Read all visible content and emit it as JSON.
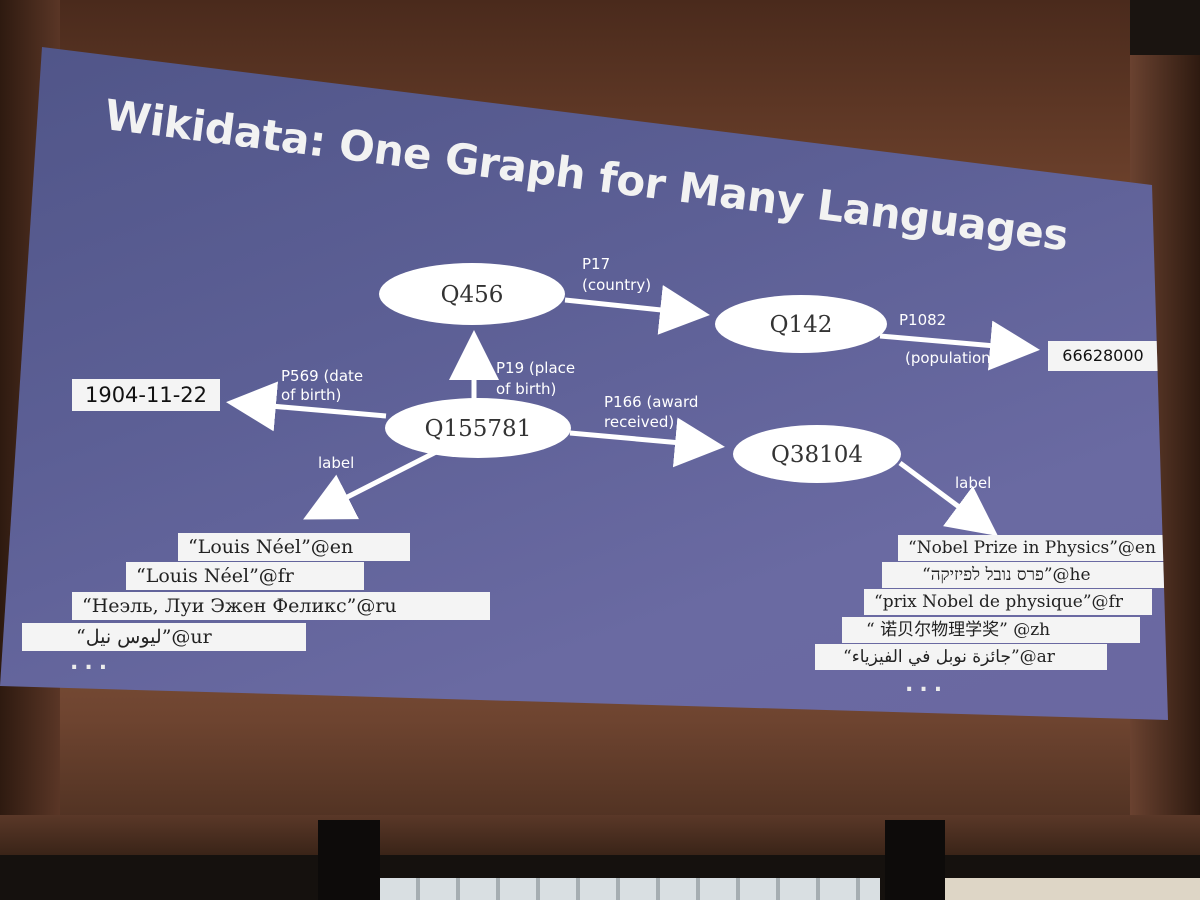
{
  "slide": {
    "title": "Wikidata: One Graph for Many Languages"
  },
  "nodes": {
    "q456": "Q456",
    "q142": "Q142",
    "q155781": "Q155781",
    "q38104": "Q38104"
  },
  "values": {
    "population": "66628000",
    "birth_date": "1904-11-22"
  },
  "edges": {
    "p17_line1": "P17",
    "p17_line2": "(country)",
    "p1082_line1": "P1082",
    "p1082_line2": "(population)",
    "p569_line1": "P569 (date",
    "p569_line2": "of birth)",
    "p19_line1": "P19 (place",
    "p19_line2": "of birth)",
    "p166_line1": "P166 (award",
    "p166_line2": "received)",
    "label_left": "label",
    "label_right": "label"
  },
  "person_labels": [
    "“Louis Néel”@en",
    "“Louis Néel”@fr",
    "“Неэль, Луи Эжен Феликс”@ru",
    "“لیوس نیل”@ur"
  ],
  "award_labels": [
    "“Nobel Prize in Physics”@en",
    "“פרס נובל לפיזיקה”@he",
    "“prix Nobel de physique”@fr",
    "“ 诺贝尔物理学奖”   @zh",
    "“جائزة نوبل في الفيزياء”@ar"
  ],
  "ellipsis_left": "...",
  "ellipsis_right": "..."
}
